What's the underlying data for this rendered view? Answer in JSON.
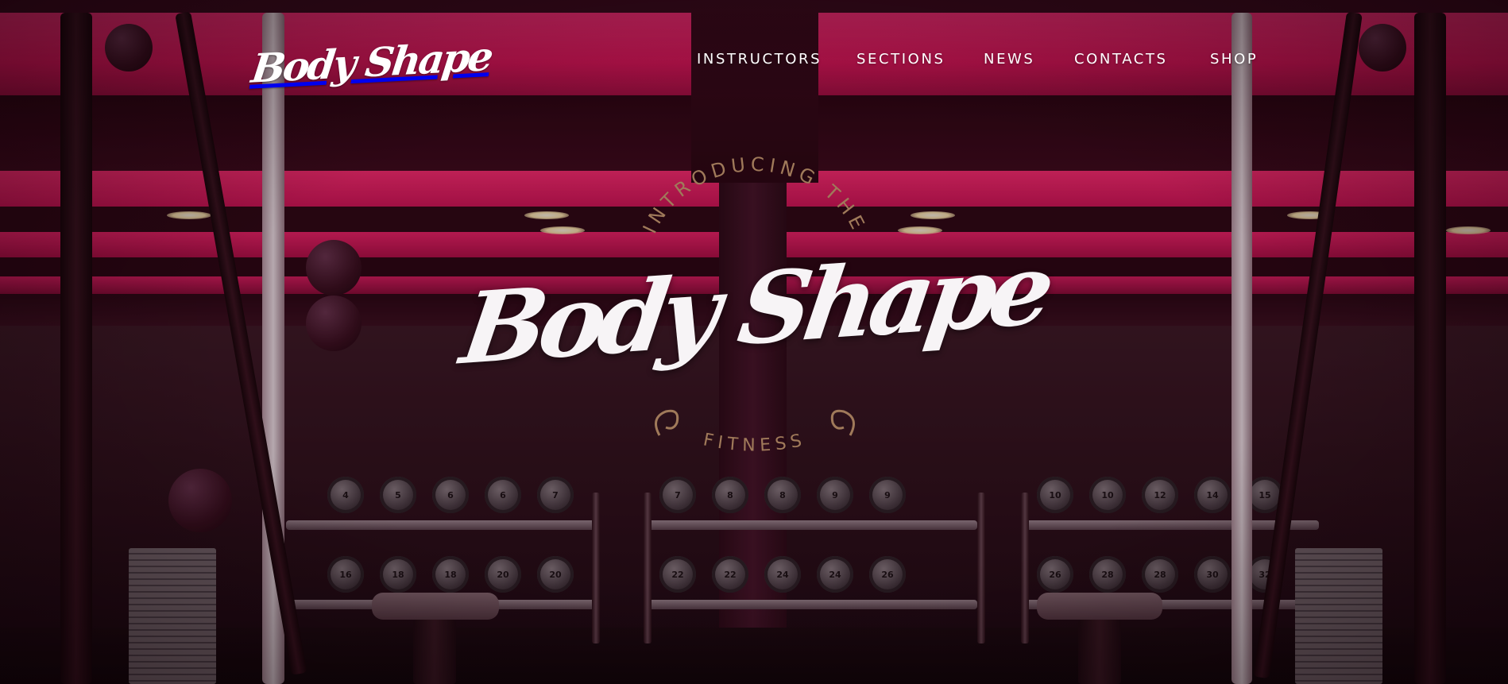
{
  "brand": {
    "logo_text": "Body Shape"
  },
  "nav": {
    "items": [
      {
        "label": "INSTRUCTORS"
      },
      {
        "label": "SECTIONS"
      },
      {
        "label": "NEWS"
      },
      {
        "label": "CONTACTS"
      },
      {
        "label": "SHOP"
      }
    ]
  },
  "hero": {
    "top_arc_text": "INTRODUCING THE",
    "logo_text": "Body Shape",
    "bottom_arc_text": "FITNESS",
    "dumbbell_labels": [
      "4",
      "5",
      "6",
      "6",
      "7",
      "7",
      "8",
      "8",
      "9",
      "9",
      "10",
      "10",
      "12",
      "14",
      "15",
      "16",
      "18",
      "18",
      "20",
      "20",
      "22",
      "22",
      "24",
      "24",
      "26",
      "26",
      "28",
      "28",
      "30",
      "32"
    ]
  },
  "colors": {
    "accent_pink": "#ff2f7a",
    "badge_gold": "#a07a5a",
    "nav_text": "#ffffff"
  }
}
